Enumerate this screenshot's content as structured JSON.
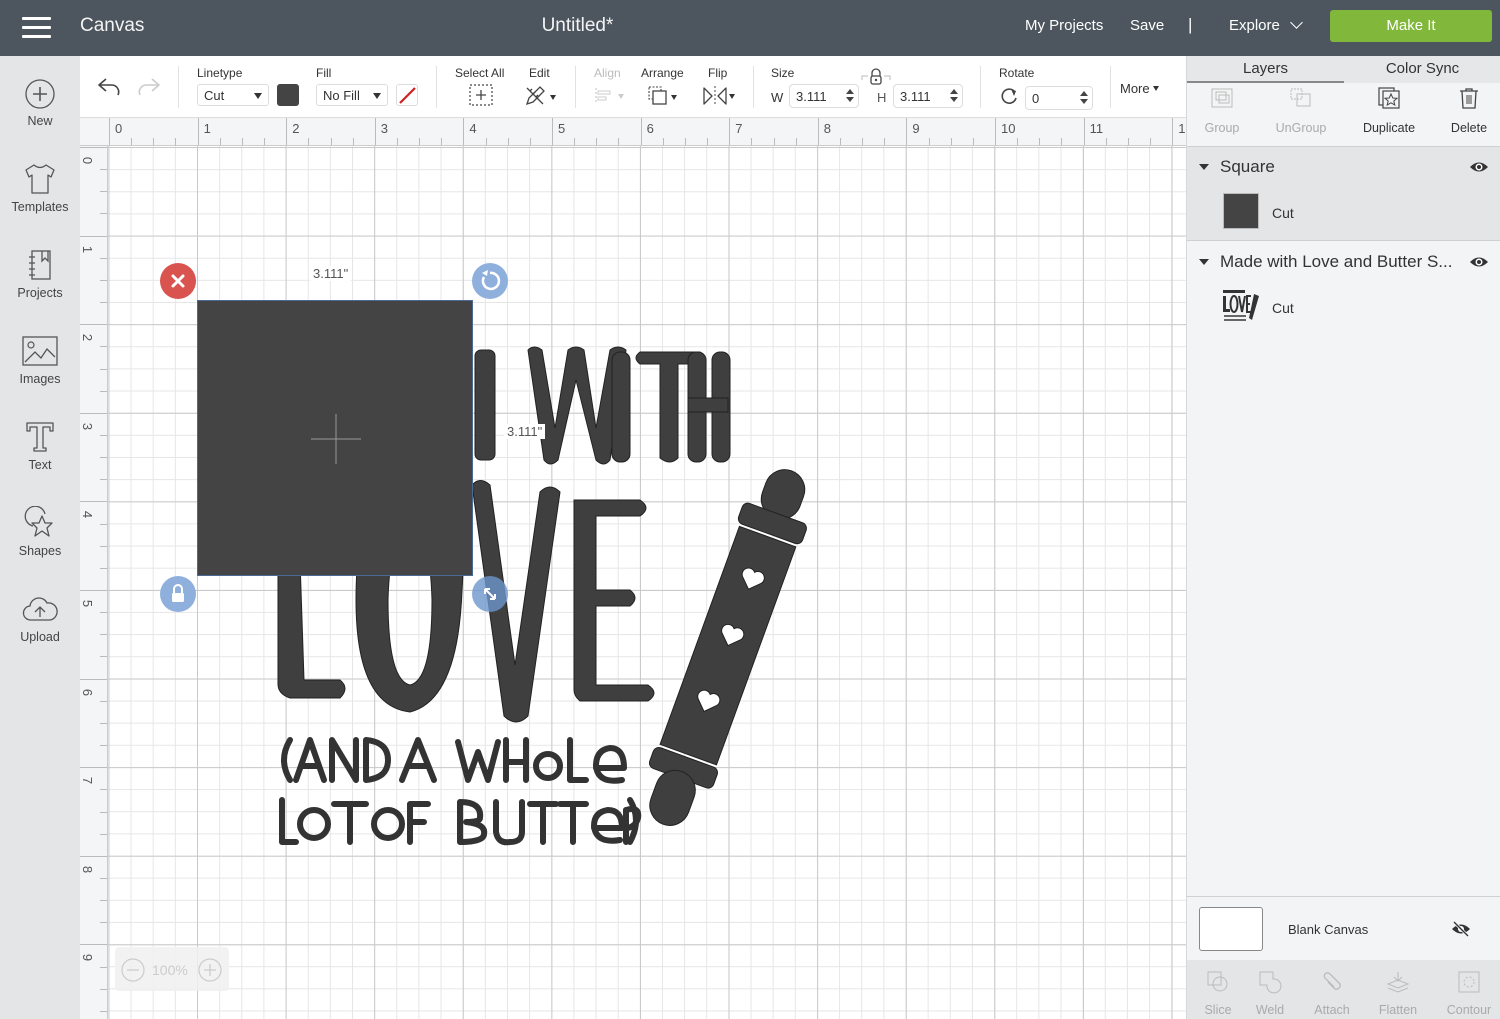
{
  "header": {
    "app_title": "Canvas",
    "doc_title": "Untitled*",
    "my_projects": "My Projects",
    "save": "Save",
    "separator": "|",
    "explore": "Explore",
    "make_it": "Make It",
    "make_it_color": "#81b83b"
  },
  "sidebar": {
    "items": [
      {
        "label": "New",
        "icon": "plus-circle-icon"
      },
      {
        "label": "Templates",
        "icon": "tshirt-icon"
      },
      {
        "label": "Projects",
        "icon": "notebook-icon"
      },
      {
        "label": "Images",
        "icon": "image-icon"
      },
      {
        "label": "Text",
        "icon": "text-t-icon"
      },
      {
        "label": "Shapes",
        "icon": "shapes-icon"
      },
      {
        "label": "Upload",
        "icon": "cloud-upload-icon"
      }
    ]
  },
  "toolbar": {
    "undo": "undo-icon",
    "redo": "redo-icon",
    "linetype_label": "Linetype",
    "linetype_value": "Cut",
    "linetype_color": "#444444",
    "fill_label": "Fill",
    "fill_value": "No Fill",
    "select_all_label": "Select All",
    "edit_label": "Edit",
    "align_label": "Align",
    "arrange_label": "Arrange",
    "flip_label": "Flip",
    "size_label": "Size",
    "width_prefix": "W",
    "width_value": "3.111",
    "height_prefix": "H",
    "height_value": "3.111",
    "rotate_label": "Rotate",
    "rotate_value": "0",
    "more_label": "More"
  },
  "rulers": {
    "top": [
      "0",
      "1",
      "2",
      "3",
      "4",
      "5",
      "6",
      "7",
      "8",
      "9",
      "10",
      "11",
      "1"
    ],
    "left": [
      "0",
      "1",
      "2",
      "3",
      "4",
      "5",
      "6",
      "7",
      "8",
      "9"
    ]
  },
  "canvas": {
    "selected_width_label": "3.111\"",
    "selected_height_label": "3.111\"",
    "square_color": "#444444",
    "delete_handle_color": "#d9534f",
    "handle_color": "#8fb0dc",
    "design_lines": [
      "MADE WITH",
      "LOVE",
      "(AND A WHOLE",
      "LOT OF BUTTER)"
    ],
    "zoom_level": "100%"
  },
  "right_panel": {
    "tabs": [
      {
        "label": "Layers",
        "active": true
      },
      {
        "label": "Color Sync",
        "active": false
      }
    ],
    "actions": [
      {
        "label": "Group",
        "enabled": false
      },
      {
        "label": "UnGroup",
        "enabled": false
      },
      {
        "label": "Duplicate",
        "enabled": true
      },
      {
        "label": "Delete",
        "enabled": true
      }
    ],
    "layers": [
      {
        "name": "Square",
        "operation": "Cut",
        "visible": true,
        "selected": true
      },
      {
        "name": "Made with Love and Butter S...",
        "operation": "Cut",
        "visible": true,
        "selected": false
      }
    ],
    "blank_canvas": {
      "label": "Blank Canvas",
      "visible": false
    },
    "bottom_actions": [
      {
        "label": "Slice"
      },
      {
        "label": "Weld"
      },
      {
        "label": "Attach"
      },
      {
        "label": "Flatten"
      },
      {
        "label": "Contour"
      }
    ]
  }
}
